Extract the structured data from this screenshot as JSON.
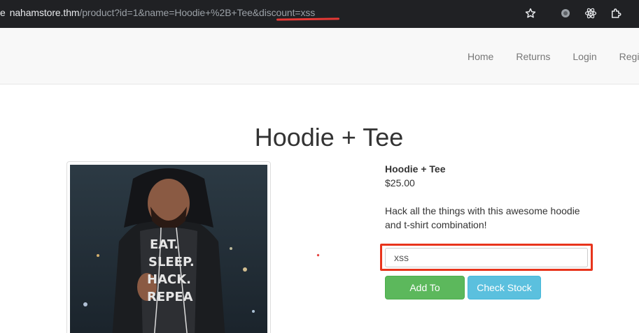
{
  "browser": {
    "url_lead": "e",
    "url_host": "nahamstore.thm",
    "url_path": "/product?id=1&name=Hoodie+%2B+Tee&",
    "url_param": "discount=xss"
  },
  "nav": {
    "items": [
      {
        "label": "Home"
      },
      {
        "label": "Returns"
      },
      {
        "label": "Login"
      },
      {
        "label": "Regis"
      }
    ]
  },
  "product": {
    "page_title": "Hoodie + Tee",
    "name": "Hoodie + Tee",
    "price": "$25.00",
    "description": "Hack all the things with this awesome hoodie and t-shirt combination!",
    "image_text": [
      "EAT.",
      "SLEEP.",
      "HACK.",
      "REPEA"
    ],
    "discount_value": "xss",
    "add_button_label": "Add To basket",
    "stock_button_label": "Check Stock"
  },
  "colors": {
    "highlight": "#e8341c",
    "success": "#5cb85c",
    "info": "#5bc0de"
  },
  "icons": [
    "star-icon",
    "extension-circle-icon",
    "react-icon",
    "puzzle-icon"
  ]
}
